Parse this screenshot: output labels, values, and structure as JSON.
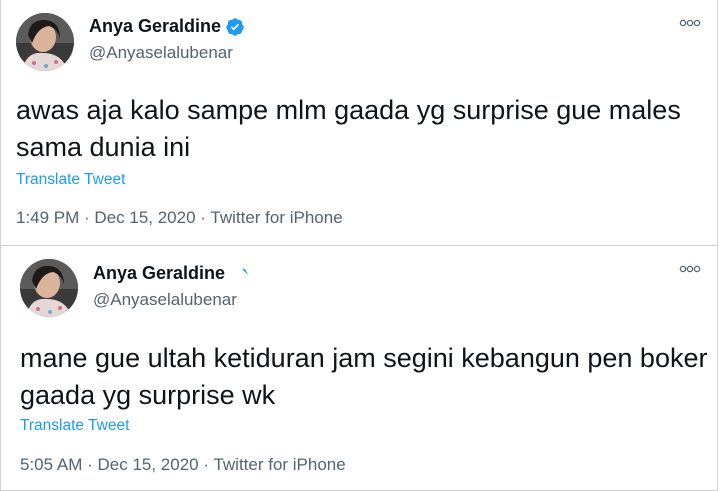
{
  "tweets": [
    {
      "name": "Anya Geraldine",
      "handle": "@Anyaselalubenar",
      "text": "awas aja kalo sampe mlm gaada yg surprise gue males sama dunia ini",
      "translate_label": "Translate Tweet",
      "time": "1:49 PM",
      "date": "Dec 15, 2020",
      "source": "Twitter for iPhone"
    },
    {
      "name": "Anya Geraldine",
      "handle": "@Anyaselalubenar",
      "text": "mane gue ultah ketiduran jam segini kebangun pen boker gaada yg surprise wk",
      "translate_label": "Translate Tweet",
      "time": "5:05 AM",
      "date": "Dec 15, 2020",
      "source": "Twitter for iPhone"
    }
  ],
  "separator": " · ",
  "colors": {
    "link": "#1d9bf0",
    "verified": "#1d9bf0",
    "muted": "#536471"
  },
  "icons": {
    "verified": "verified-badge-icon",
    "more": "more-options-icon"
  }
}
